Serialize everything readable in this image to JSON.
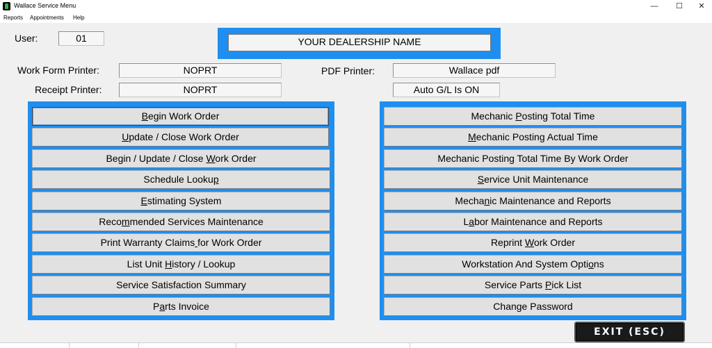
{
  "window": {
    "title": "Wallace Service Menu",
    "minimize_glyph": "—",
    "maximize_glyph": "☐",
    "close_glyph": "✕"
  },
  "menubar": [
    "Reports",
    "Appointments",
    "Help"
  ],
  "user": {
    "label": "User:",
    "value": "01"
  },
  "dealership": {
    "name": "YOUR DEALERSHIP NAME"
  },
  "printers": {
    "work_form_label": "Work Form Printer:",
    "work_form_value": "NOPRT",
    "receipt_label": "Receipt Printer:",
    "receipt_value": "NOPRT",
    "pdf_label": "PDF Printer:",
    "pdf_value": "Wallace pdf",
    "auto_gl_value": "Auto G/L Is ON"
  },
  "left_menu": [
    {
      "label": "Begin Work Order",
      "hotkey": 0
    },
    {
      "label": "Update / Close Work Order",
      "hotkey": 0
    },
    {
      "label": "Begin / Update / Close Work Order",
      "hotkey": 23
    },
    {
      "label": "Schedule Lookup",
      "hotkey": 14
    },
    {
      "label": "Estimating System",
      "hotkey": 0
    },
    {
      "label": "Recommended Services Maintenance",
      "hotkey": 4
    },
    {
      "label": "Print Warranty Claims for Work Order",
      "hotkey": 21
    },
    {
      "label": "List Unit History / Lookup",
      "hotkey": 10
    },
    {
      "label": "Service Satisfaction Summary",
      "hotkey": -1
    },
    {
      "label": "Parts Invoice",
      "hotkey": 1
    }
  ],
  "right_menu": [
    {
      "label": "Mechanic Posting Total Time",
      "hotkey": 9
    },
    {
      "label": "Mechanic Posting Actual Time",
      "hotkey": 0
    },
    {
      "label": "Mechanic Posting Total Time By Work Order",
      "hotkey": -1
    },
    {
      "label": "Service Unit Maintenance",
      "hotkey": 0
    },
    {
      "label": "Mechanic Maintenance and Reports",
      "hotkey": 5
    },
    {
      "label": "Labor Maintenance and Reports",
      "hotkey": 1
    },
    {
      "label": "Reprint Work Order",
      "hotkey": 8
    },
    {
      "label": "Workstation And System Options",
      "hotkey": 27
    },
    {
      "label": "Service Parts Pick List",
      "hotkey": 14
    },
    {
      "label": "Change Password",
      "hotkey": -1
    }
  ],
  "exit_button": {
    "label": "EXIT (ESC)"
  }
}
